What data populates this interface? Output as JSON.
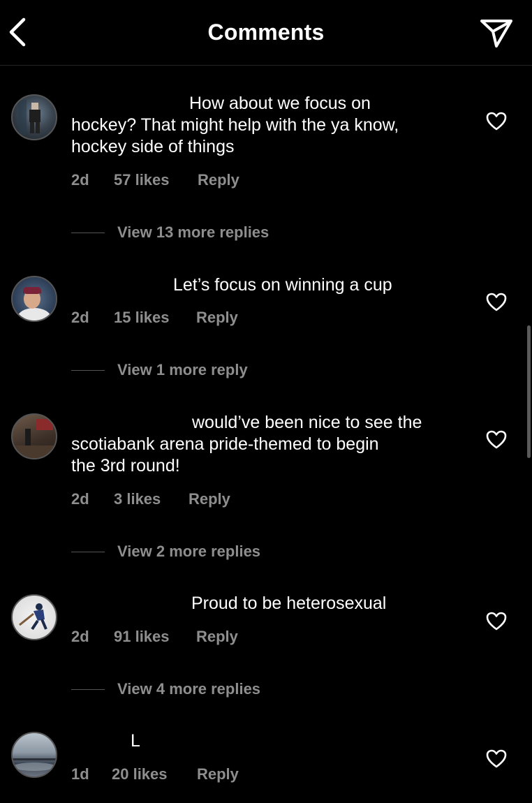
{
  "header": {
    "title": "Comments"
  },
  "icons": {
    "back": "chevron-left-icon",
    "send": "paper-plane-icon",
    "like": "heart-icon"
  },
  "colors": {
    "background": "#000000",
    "text": "#ffffff",
    "secondary": "#8e8e8e"
  },
  "comments": [
    {
      "lines": [
        "How about we focus on",
        "hockey? That might help with the ya know,",
        "hockey side of things"
      ],
      "time": "2d",
      "likes": "57 likes",
      "reply": "Reply",
      "view_replies": "View 13 more replies"
    },
    {
      "lines": [
        "Let’s focus on winning a cup"
      ],
      "time": "2d",
      "likes": "15 likes",
      "reply": "Reply",
      "view_replies": "View 1 more reply"
    },
    {
      "lines": [
        "would’ve been nice to see the",
        "scotiabank arena pride-themed to begin",
        "the 3rd round!"
      ],
      "time": "2d",
      "likes": "3 likes",
      "reply": "Reply",
      "view_replies": "View 2 more replies"
    },
    {
      "lines": [
        "Proud to be heterosexual"
      ],
      "time": "2d",
      "likes": "91 likes",
      "reply": "Reply",
      "view_replies": "View 4 more replies"
    },
    {
      "lines": [
        "L"
      ],
      "time": "1d",
      "likes": "20 likes",
      "reply": "Reply",
      "view_replies": ""
    }
  ]
}
